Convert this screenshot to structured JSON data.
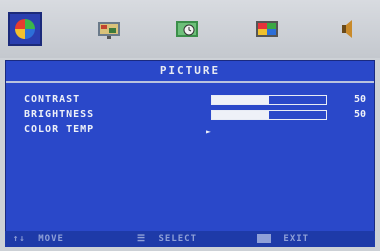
{
  "icons": [
    {
      "name": "picture",
      "icon": "color-wheel-icon",
      "active": true
    },
    {
      "name": "image-setup",
      "icon": "image-setup-icon",
      "active": false
    },
    {
      "name": "osd-timer",
      "icon": "clock-settings-icon",
      "active": false
    },
    {
      "name": "color",
      "icon": "color-palette-icon",
      "active": false
    },
    {
      "name": "audio",
      "icon": "speaker-icon",
      "active": false
    }
  ],
  "panel": {
    "title": "PICTURE",
    "items": [
      {
        "label": "CONTRAST",
        "value": "50",
        "level": 0.5
      },
      {
        "label": "BRIGHTNESS",
        "value": "50",
        "level": 0.5
      },
      {
        "label": "COLOR TEMP"
      }
    ]
  },
  "footer": {
    "move": "MOVE",
    "select": "SELECT",
    "exit": "EXIT"
  },
  "colors": {
    "panel": "#2a48c9",
    "active_icon_bg": "#2a3fb0",
    "text": "#eef1f8"
  }
}
